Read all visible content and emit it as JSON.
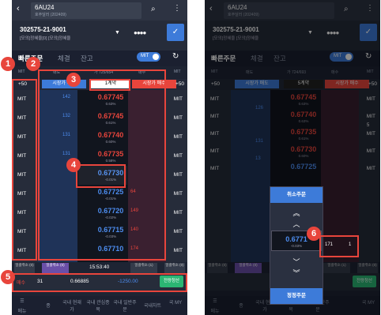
{
  "left": {
    "symbol": "6AU24",
    "symbol_sub": "호주달러 (202409)",
    "account": "302575-21-9001",
    "account_sub": "[모의]정혜율[0] [모의]정혜율",
    "password_dots": "●●●●",
    "tabs": [
      "빠른주문",
      "체결",
      "잔고"
    ],
    "mit_label": "MIT",
    "col_headers": [
      "MIT",
      "매도",
      "가 725/654",
      "매수",
      "MIT"
    ],
    "plus50": "+50",
    "market_sell": "시장가 매도",
    "qty": "1계약",
    "market_buy": "시장가 매수",
    "rows": [
      {
        "sell": "142",
        "price": "0.67745",
        "pct": "0.63%",
        "buy": ""
      },
      {
        "sell": "132",
        "price": "0.67745",
        "pct": "0.61%",
        "buy": ""
      },
      {
        "sell": "131",
        "price": "0.67740",
        "pct": "0.60%",
        "buy": ""
      },
      {
        "sell": "131",
        "price": "0.67735",
        "pct": "0.58%",
        "buy": ""
      },
      {
        "sell": "",
        "price": "0.67730",
        "pct": "-0.01%",
        "buy": ""
      },
      {
        "sell": "",
        "price": "0.67725",
        "pct": "-0.01%",
        "buy": "64"
      },
      {
        "sell": "",
        "price": "0.67720",
        "pct": "-0.02%",
        "buy": "149"
      },
      {
        "sell": "",
        "price": "0.67715",
        "pct": "-0.03%",
        "buy": "140"
      },
      {
        "sell": "",
        "price": "0.67710",
        "pct": "",
        "buy": "174"
      }
    ],
    "bottom": [
      "일괄취소 (0)",
      "일괄취소 (0)",
      "15:53:40",
      "일괄취소 (1)",
      "일괄취소 (0)"
    ],
    "input_row": {
      "label": "매수",
      "qty": "31",
      "price": "0.66885",
      "pnl": "-1250.00",
      "btn": "전량청산"
    },
    "nav": [
      "메뉴",
      "종",
      "국내 현재가",
      "국내 관심종목",
      "국내 일반주문",
      "국내차트",
      "국 MY"
    ]
  },
  "right": {
    "symbol": "6AU24",
    "symbol_sub": "호주달러 (202409)",
    "account": "302575-21-9001",
    "account_sub": "[모의]정혜율 [모의]정혜율",
    "password_dots": "●●●●",
    "tabs": [
      "빠른주문",
      "체결",
      "잔고"
    ],
    "mit_label": "MIT",
    "col_headers": [
      "MIT",
      "매도",
      "가 724/693",
      "매수",
      "MIT"
    ],
    "plus50": "+50",
    "market_sell": "시장가 매도",
    "qty": "5계약",
    "market_buy": "시장가 매수",
    "rows": [
      {
        "price": "0.67745",
        "pct": "0.63%"
      },
      {
        "price": "0.67740",
        "pct": "0.63%"
      },
      {
        "price": "0.67735",
        "pct": "0.61%"
      },
      {
        "price": "0.67730",
        "pct": "0.60%"
      },
      {
        "price": "0.67725",
        "pct": ""
      }
    ],
    "side_values": [
      "126",
      "131",
      "13",
      "5"
    ],
    "popup": {
      "title": "취소주문",
      "price": "0.6771",
      "pct": "-0.03%",
      "correct": "정정주문"
    },
    "order_qty": "171",
    "order_cnt": "1",
    "bottom": [
      "일괄취소 (0)",
      "일괄취소 (0)",
      "일괄취소 (1)",
      "일괄취소 (0)"
    ],
    "nav": [
      "메뉴",
      "종",
      "국내 현재가",
      "국내 관심종목",
      "국내 일반주문",
      "국 MY"
    ],
    "clear_btn": "전량청산"
  },
  "badges": [
    "1",
    "2",
    "3",
    "4",
    "5",
    "6"
  ],
  "colors": {
    "accent": "#3d7bd9",
    "sell": "#4d8df0",
    "buy": "#e8453c",
    "badge": "#e8453c"
  }
}
